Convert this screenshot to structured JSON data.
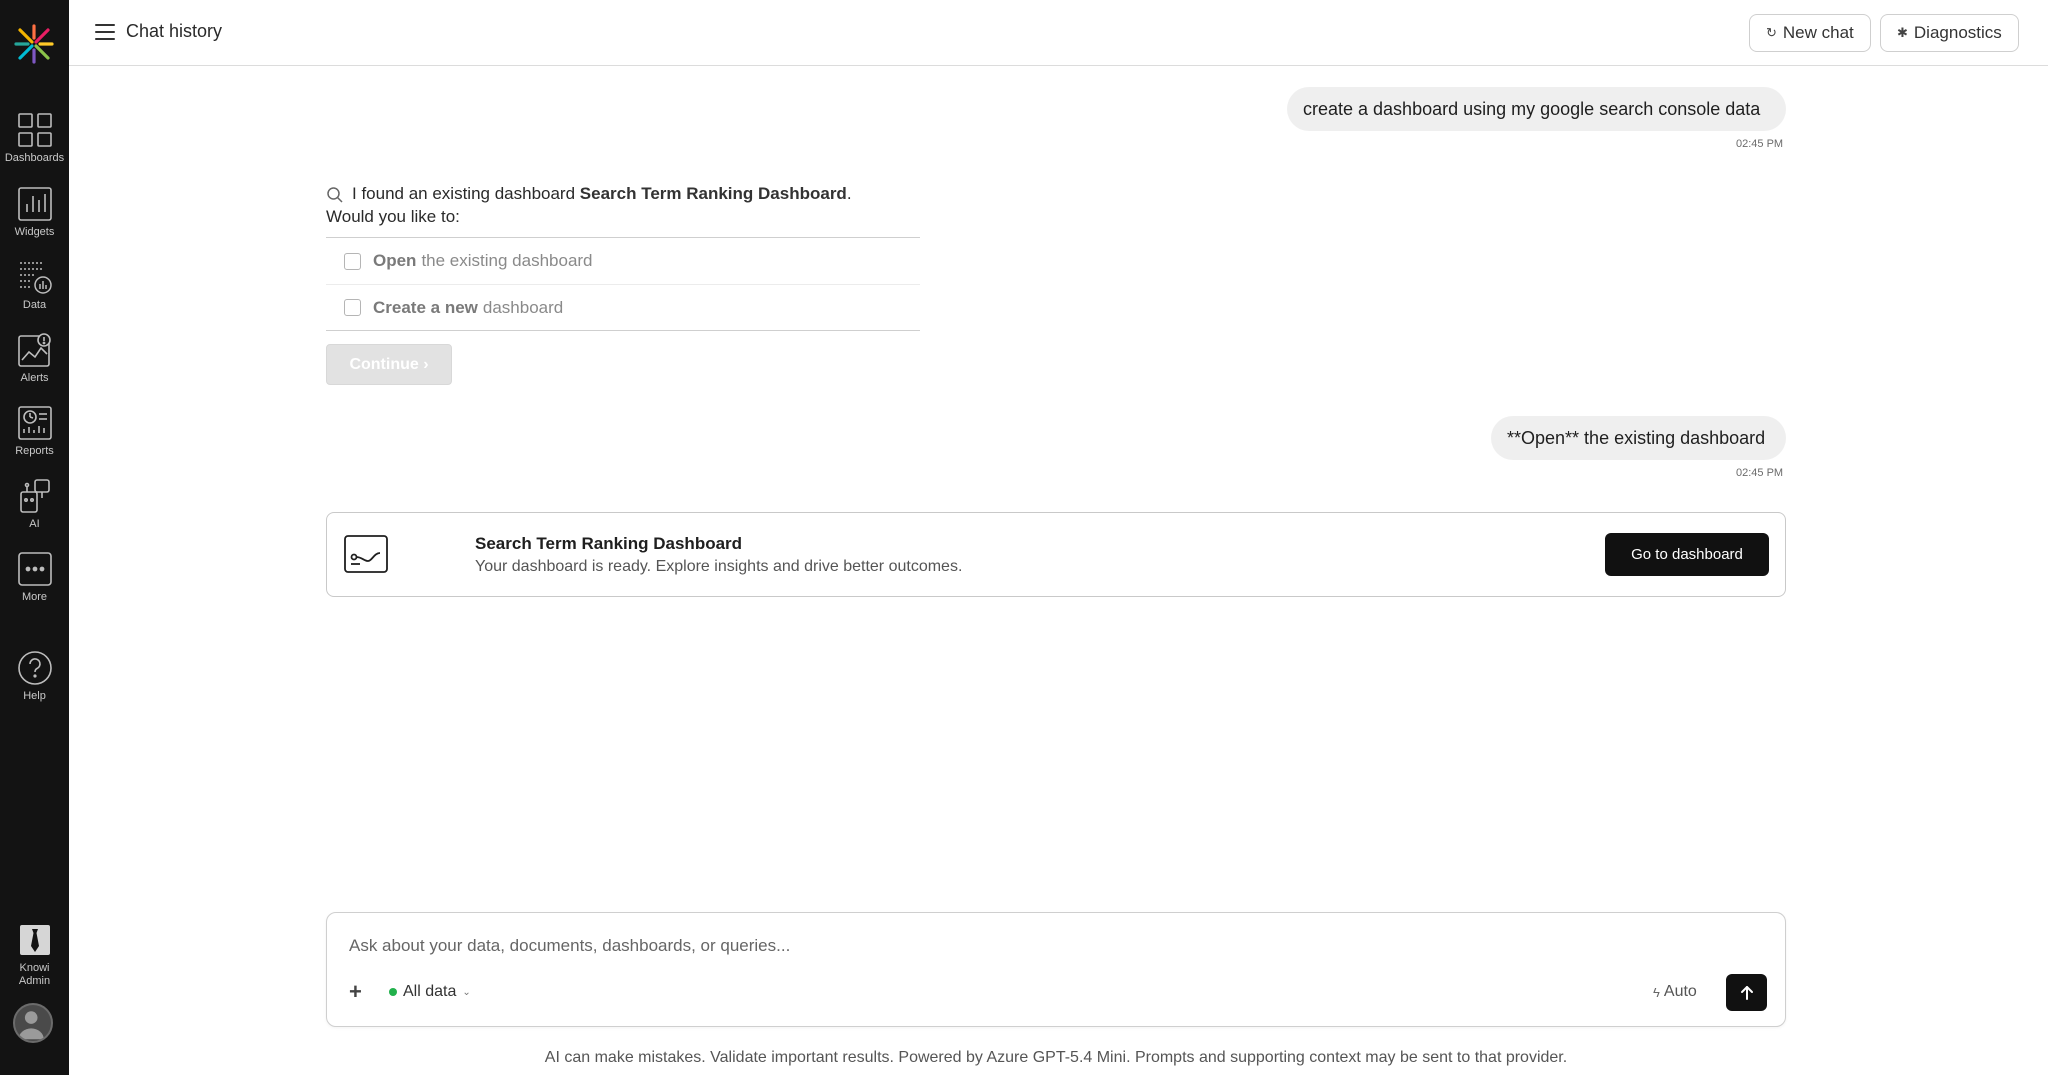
{
  "header": {
    "title": "Chat history",
    "new_chat_label": "New chat",
    "diagnostics_label": "Diagnostics"
  },
  "sidebar": {
    "items": [
      {
        "label": "Dashboards",
        "icon": "dashboards-icon"
      },
      {
        "label": "Widgets",
        "icon": "widgets-icon"
      },
      {
        "label": "Data",
        "icon": "data-icon"
      },
      {
        "label": "Alerts",
        "icon": "alerts-icon"
      },
      {
        "label": "Reports",
        "icon": "reports-icon"
      },
      {
        "label": "AI",
        "icon": "ai-icon"
      },
      {
        "label": "More",
        "icon": "more-icon"
      },
      {
        "label": "Help",
        "icon": "help-icon"
      }
    ],
    "admin_label_line1": "Knowi",
    "admin_label_line2": "Admin"
  },
  "messages": {
    "user1": {
      "text": "create a dashboard using my google search console data",
      "time": "02:45 PM"
    },
    "bot": {
      "intro_prefix": "I found an existing dashboard ",
      "intro_dashboard": "Search Term Ranking Dashboard",
      "intro_suffix": ".",
      "question": "Would you like to:",
      "options": [
        {
          "bold": "Open",
          "rest": "the existing dashboard"
        },
        {
          "bold": "Create a new",
          "rest": "dashboard"
        }
      ],
      "continue_label": "Continue ›"
    },
    "user2": {
      "text": "**Open** the existing dashboard",
      "time": "02:45 PM"
    },
    "card": {
      "title": "Search Term Ranking Dashboard",
      "subtitle": "Your dashboard is ready. Explore insights and drive better outcomes.",
      "button": "Go to dashboard"
    }
  },
  "composer": {
    "placeholder": "Ask about your data, documents, dashboards, or queries...",
    "source": "All data",
    "mode": "Auto"
  },
  "disclaimer": "AI can make mistakes. Validate important results. Powered by Azure GPT-5.4 Mini. Prompts and supporting context may be sent to that provider.",
  "colors": {
    "sidebar_bg": "#131313",
    "primary_button": "#111111",
    "status_dot": "#22b14c"
  }
}
